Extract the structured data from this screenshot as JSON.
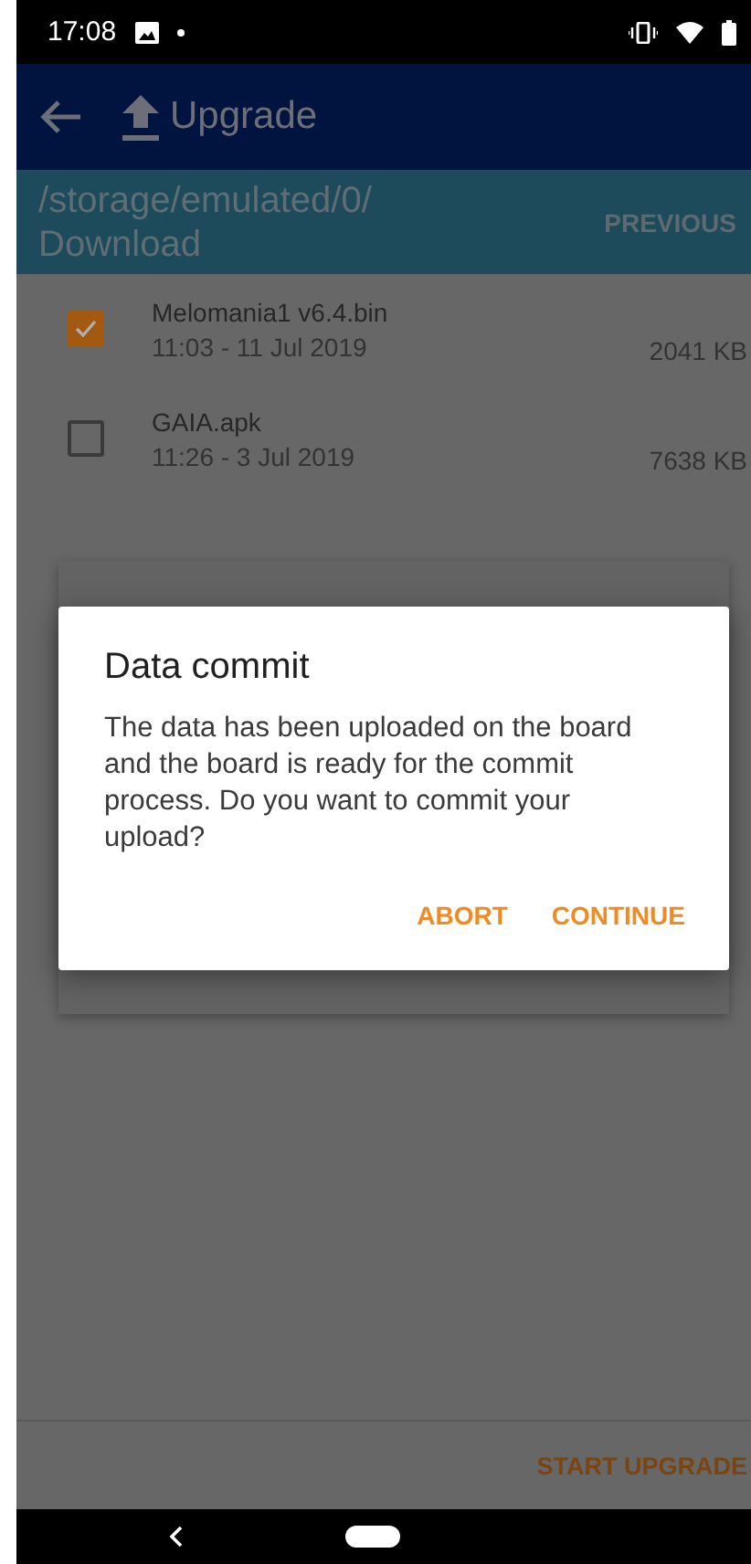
{
  "status_bar": {
    "time": "17:08"
  },
  "app_bar": {
    "title": "Upgrade"
  },
  "path_bar": {
    "path": "/storage/emulated/0/Download",
    "previous_button": "PREVIOUS"
  },
  "files": [
    {
      "name": "Melomania1 v6.4.bin",
      "modified": "11:03 - 11 Jul 2019",
      "size": "2041 KB",
      "checked": true
    },
    {
      "name": "GAIA.apk",
      "modified": "11:26 - 3 Jul 2019",
      "size": "7638 KB",
      "checked": false
    }
  ],
  "dialog": {
    "title": "Data commit",
    "message": "The data has been uploaded on the board and the board is ready for the commit process. Do you want to commit your upload?",
    "buttons": [
      "ABORT",
      "CONTINUE"
    ]
  },
  "footer": {
    "start_button": "START UPGRADE"
  }
}
